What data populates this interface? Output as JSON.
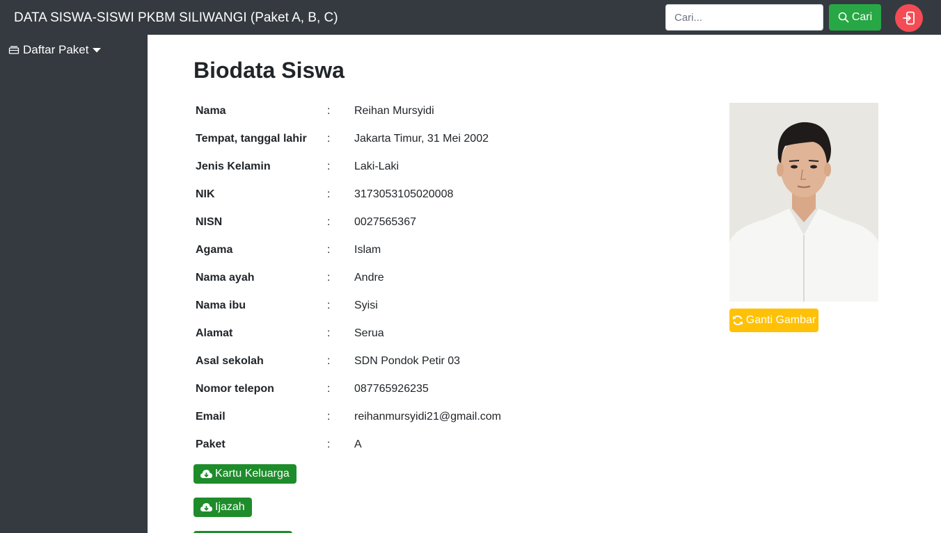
{
  "navbar": {
    "brand": "DATA SISWA-SISWI PKBM SILIWANGI (Paket A, B, C)",
    "search_placeholder": "Cari...",
    "search_label": "Cari"
  },
  "sidebar": {
    "items": [
      {
        "label": "Daftar Paket"
      }
    ]
  },
  "main": {
    "title": "Biodata Siswa",
    "colon": ":",
    "fields": [
      {
        "label": "Nama",
        "value": "Reihan Mursyidi"
      },
      {
        "label": "Tempat, tanggal lahir",
        "value": "Jakarta Timur, 31 Mei 2002"
      },
      {
        "label": "Jenis Kelamin",
        "value": "Laki-Laki"
      },
      {
        "label": "NIK",
        "value": "3173053105020008"
      },
      {
        "label": "NISN",
        "value": "0027565367"
      },
      {
        "label": "Agama",
        "value": "Islam"
      },
      {
        "label": "Nama ayah",
        "value": "Andre"
      },
      {
        "label": "Nama ibu",
        "value": "Syisi"
      },
      {
        "label": "Alamat",
        "value": "Serua"
      },
      {
        "label": "Asal sekolah",
        "value": "SDN Pondok Petir 03"
      },
      {
        "label": "Nomor telepon",
        "value": "087765926235"
      },
      {
        "label": "Email",
        "value": "reihanmursyidi21@gmail.com"
      },
      {
        "label": "Paket",
        "value": "A"
      }
    ],
    "change_photo_label": "Ganti Gambar",
    "download_buttons": [
      {
        "label": "Kartu Keluarga"
      },
      {
        "label": "Ijazah"
      }
    ]
  },
  "colors": {
    "navbar_bg": "#343a40",
    "search_button": "#28a745",
    "logout_button": "#f44c55",
    "change_photo_button": "#ffc107",
    "download_button": "#1e8c2b"
  },
  "icons": {
    "search": "search-icon",
    "logout": "logout-icon",
    "sidebar_item": "layers-icon",
    "dropdown": "caret-down-icon",
    "change_photo": "refresh-icon",
    "download": "cloud-download-icon"
  }
}
